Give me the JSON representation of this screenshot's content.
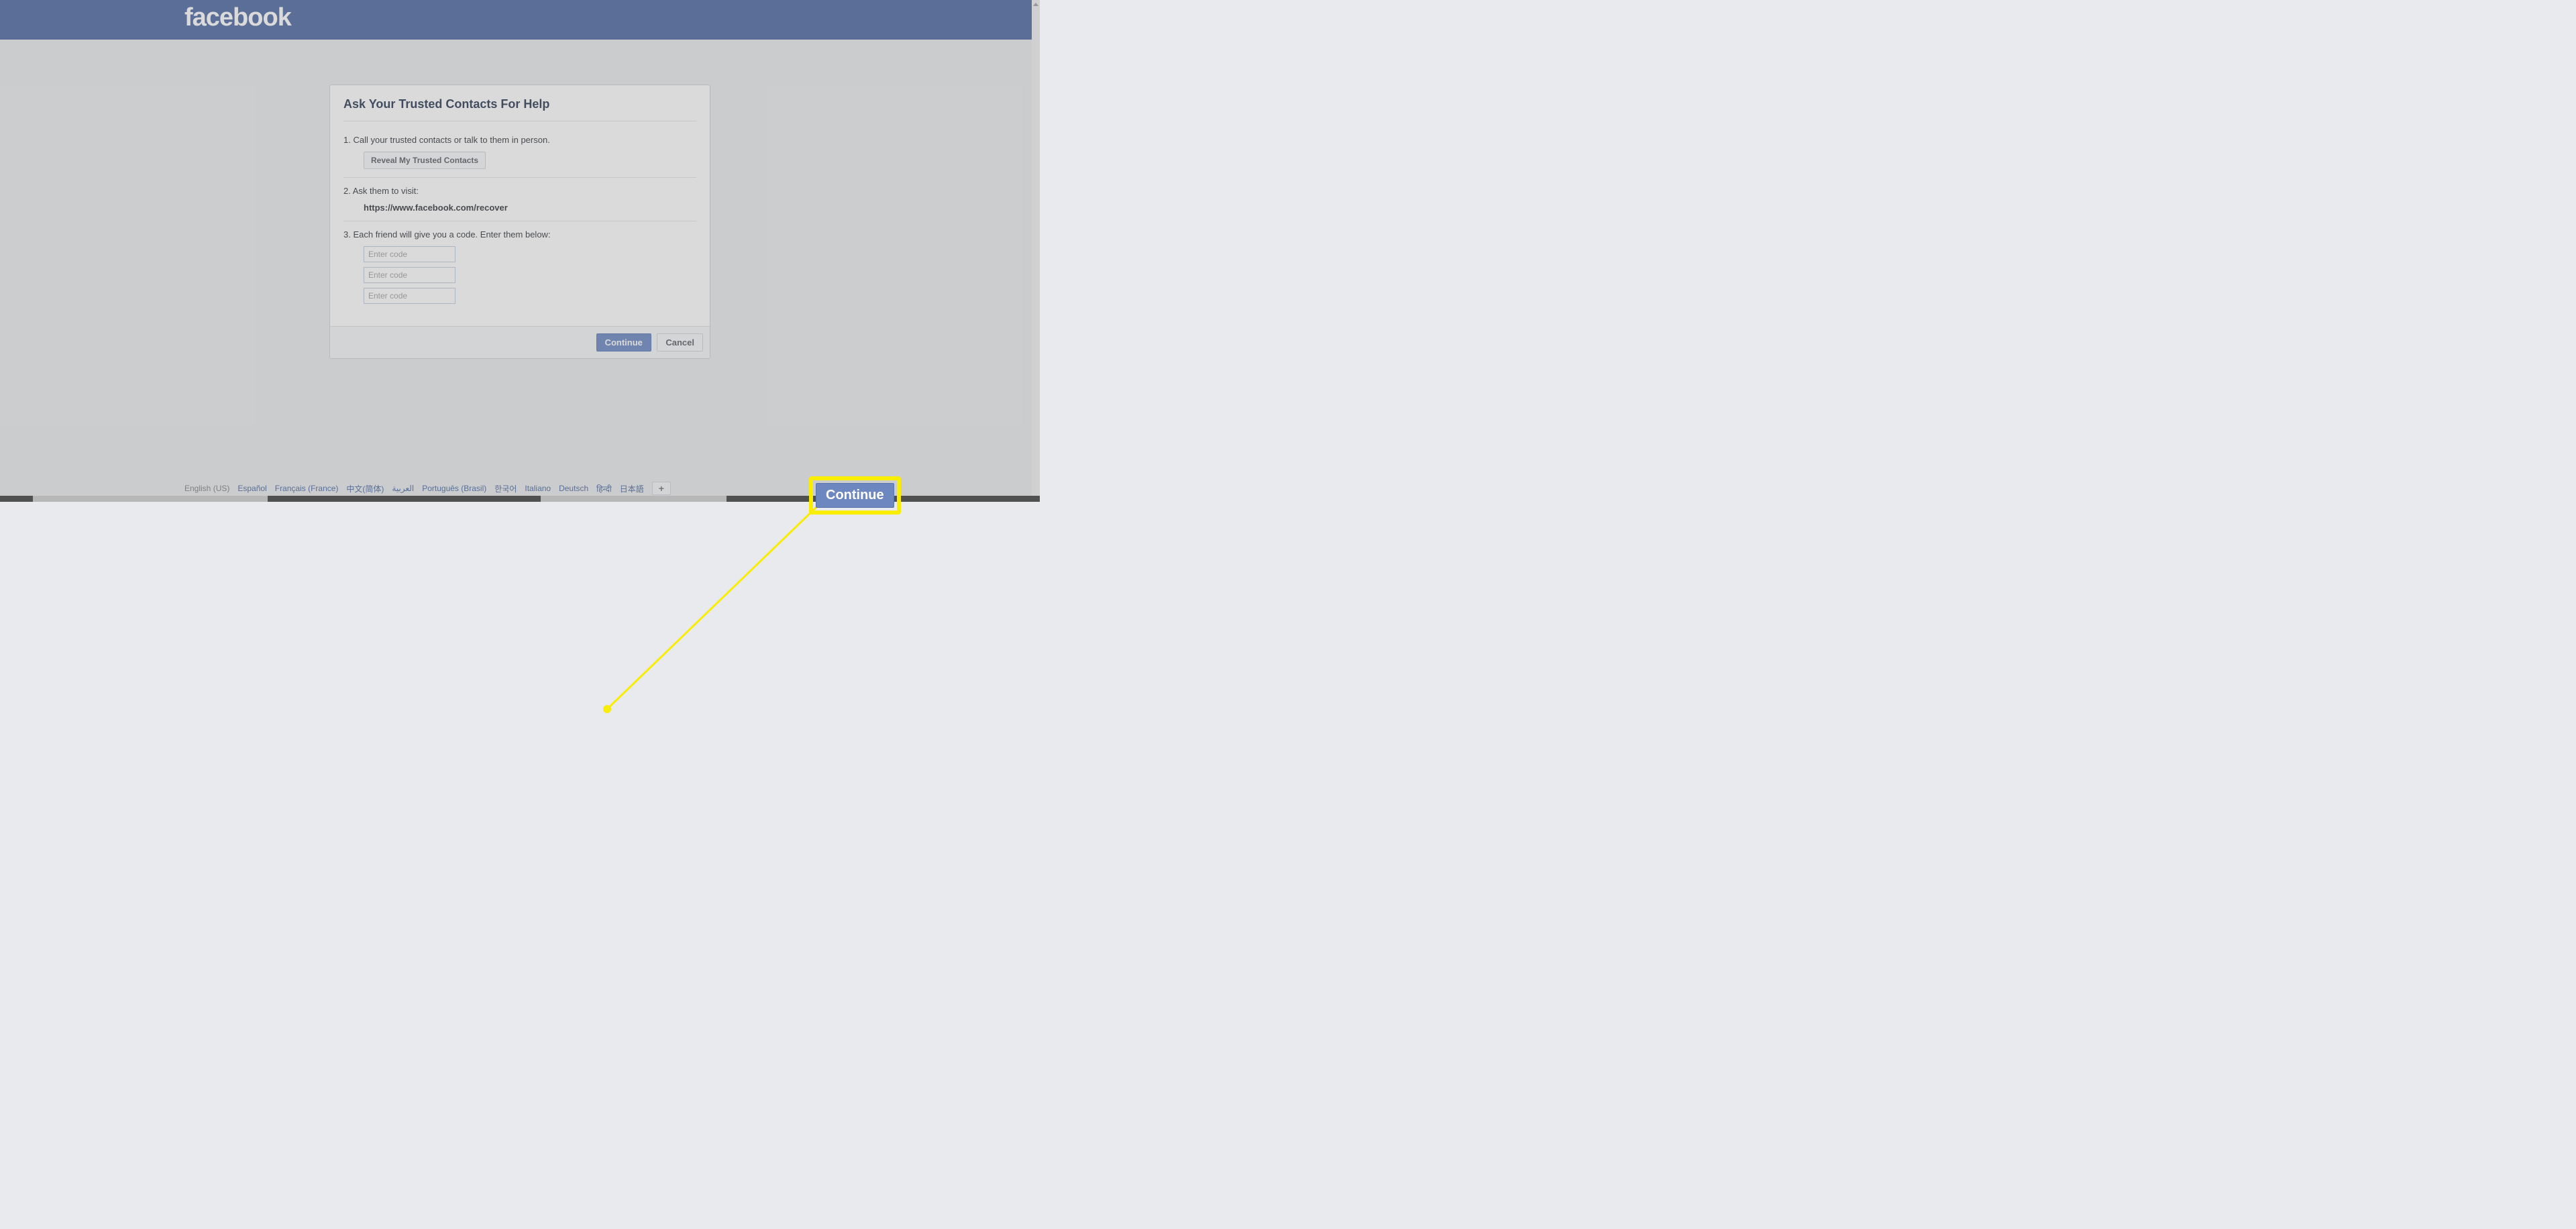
{
  "header": {
    "logo": "facebook"
  },
  "card": {
    "title": "Ask Your Trusted Contacts For Help",
    "step1": {
      "text": "1. Call your trusted contacts or talk to them in person.",
      "button": "Reveal My Trusted Contacts"
    },
    "step2": {
      "text": "2. Ask them to visit:",
      "url": "https://www.facebook.com/recover"
    },
    "step3": {
      "text": "3. Each friend will give you a code. Enter them below:",
      "placeholder": "Enter code"
    },
    "footer": {
      "continue": "Continue",
      "cancel": "Cancel"
    }
  },
  "languages": {
    "current": "English (US)",
    "items": [
      "Español",
      "Français (France)",
      "中文(简体)",
      "العربية",
      "Português (Brasil)",
      "한국어",
      "Italiano",
      "Deutsch",
      "हिन्दी",
      "日本語"
    ],
    "plus": "+"
  },
  "callout": {
    "label": "Continue"
  }
}
